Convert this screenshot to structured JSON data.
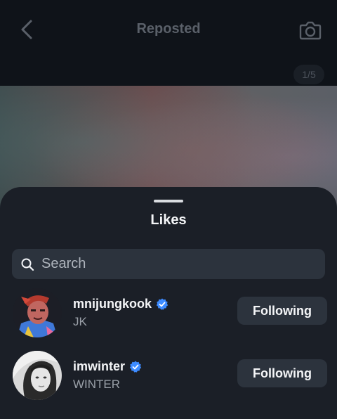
{
  "header": {
    "title": "Reposted",
    "page_indicator": "1/5",
    "back_icon": "chevron-left-icon",
    "camera_icon": "camera-icon"
  },
  "likes_sheet": {
    "title": "Likes",
    "search": {
      "placeholder": "Search",
      "value": "",
      "icon": "search-icon"
    },
    "users": [
      {
        "username": "mnijungkook",
        "full_name": "JK",
        "verified": true,
        "button_label": "Following",
        "avatar": "animated-character-avatar"
      },
      {
        "username": "imwinter",
        "full_name": "WINTER",
        "verified": true,
        "button_label": "Following",
        "avatar": "grayscale-portrait-avatar"
      }
    ]
  },
  "colors": {
    "background": "#0f1319",
    "sheet": "#1b1f27",
    "button": "#2c333d",
    "verified_badge": "#3d8bff",
    "secondary_text": "#9aa0a8"
  }
}
